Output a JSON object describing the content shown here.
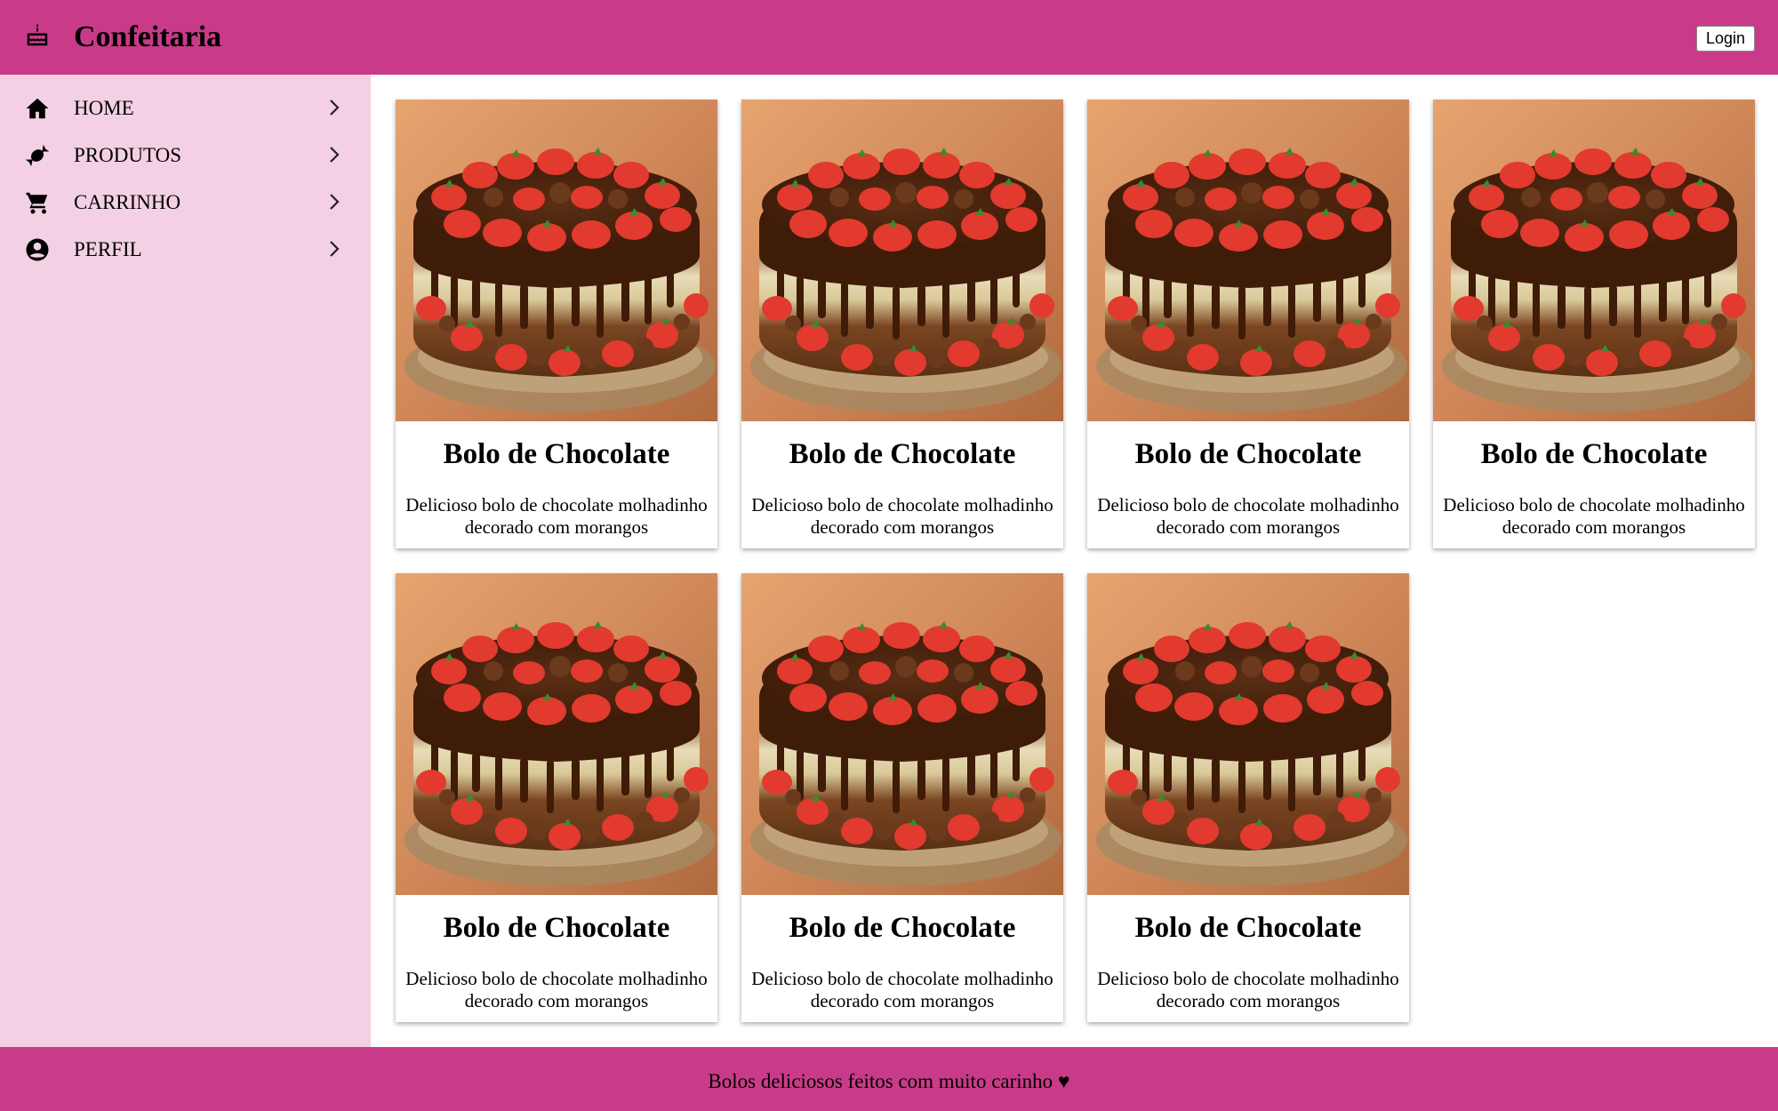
{
  "header": {
    "brand_icon": "cake-icon",
    "title": "Confeitaria",
    "login_label": "Login"
  },
  "sidebar": {
    "items": [
      {
        "label": "HOME",
        "icon": "home-icon"
      },
      {
        "label": "PRODUTOS",
        "icon": "candy-icon"
      },
      {
        "label": "CARRINHO",
        "icon": "cart-icon"
      },
      {
        "label": "PERFIL",
        "icon": "account-circle-icon"
      }
    ]
  },
  "products": [
    {
      "title": "Bolo de Chocolate",
      "description": "Delicioso bolo de chocolate molhadinho decorado com morangos"
    },
    {
      "title": "Bolo de Chocolate",
      "description": "Delicioso bolo de chocolate molhadinho decorado com morangos"
    },
    {
      "title": "Bolo de Chocolate",
      "description": "Delicioso bolo de chocolate molhadinho decorado com morangos"
    },
    {
      "title": "Bolo de Chocolate",
      "description": "Delicioso bolo de chocolate molhadinho decorado com morangos"
    },
    {
      "title": "Bolo de Chocolate",
      "description": "Delicioso bolo de chocolate molhadinho decorado com morangos"
    },
    {
      "title": "Bolo de Chocolate",
      "description": "Delicioso bolo de chocolate molhadinho decorado com morangos"
    },
    {
      "title": "Bolo de Chocolate",
      "description": "Delicioso bolo de chocolate molhadinho decorado com morangos"
    }
  ],
  "footer": {
    "text": "Bolos deliciosos feitos com muito carinho ♥"
  },
  "colors": {
    "header_bg": "#c93b88",
    "sidebar_bg": "#f3d0e3",
    "footer_bg": "#c93b88"
  }
}
